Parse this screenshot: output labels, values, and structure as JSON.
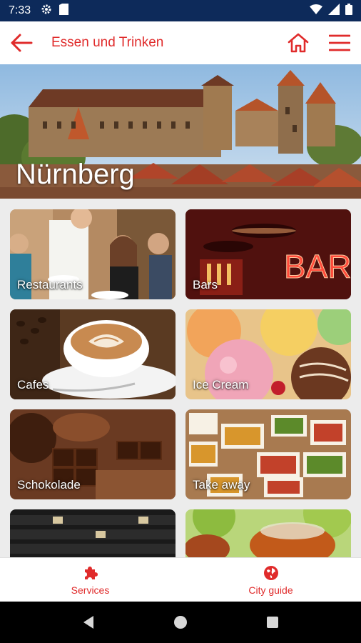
{
  "status_bar": {
    "time": "7:33",
    "icons": [
      "gear-icon",
      "sim-card-icon",
      "wifi-icon",
      "signal-icon",
      "battery-icon"
    ]
  },
  "app_bar": {
    "title": "Essen und Trinken",
    "back_icon": "arrow-left-icon",
    "home_icon": "home-icon",
    "menu_icon": "hamburger-menu-icon"
  },
  "hero": {
    "city": "Nürnberg"
  },
  "categories": [
    {
      "label": "Restaurants"
    },
    {
      "label": "Bars"
    },
    {
      "label": "Cafes"
    },
    {
      "label": "Ice Cream"
    },
    {
      "label": "Schokolade"
    },
    {
      "label": "Take away"
    },
    {
      "label": ""
    },
    {
      "label": ""
    }
  ],
  "bottom_nav": {
    "services": "Services",
    "city_guide": "City guide"
  },
  "colors": {
    "accent": "#e02b2b",
    "status_bar": "#0d2a5a",
    "grid_background": "#ececec"
  }
}
